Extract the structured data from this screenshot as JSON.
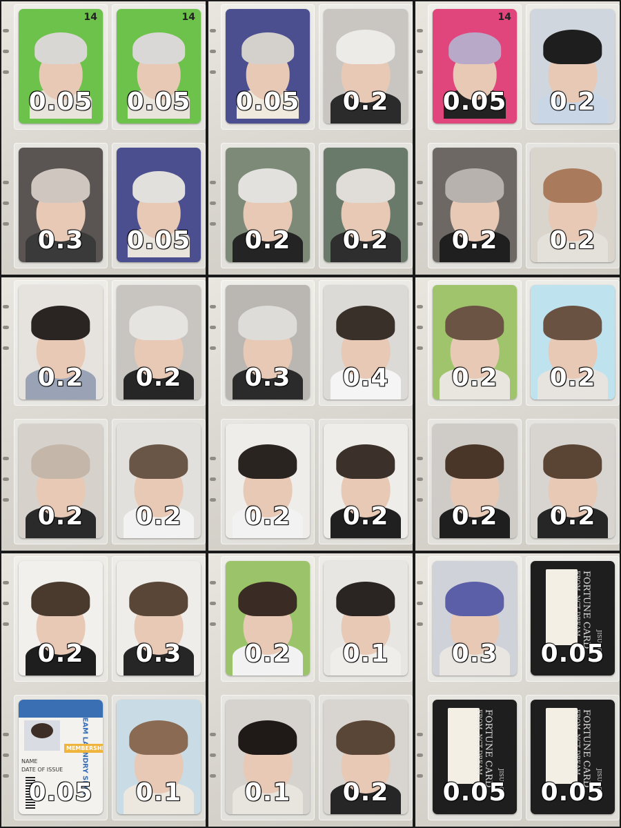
{
  "pages": [
    {
      "name": "page-1",
      "cards": [
        {
          "price": "0.05",
          "hair": "#d9d7d4",
          "bg": "#6cc24a",
          "shirt": "#e8e4dc",
          "frame": "green",
          "badge": "14"
        },
        {
          "price": "0.05",
          "hair": "#dad8d6",
          "bg": "#6cc24a",
          "shirt": "#e8e4dc",
          "frame": "green",
          "badge": "14"
        },
        {
          "price": "0.3",
          "hair": "#cfc7bf",
          "bg": "#5a5552",
          "shirt": "#3a3a3a",
          "frame": "none"
        },
        {
          "price": "0.05",
          "hair": "#e2e0dd",
          "bg": "#4b4f8f",
          "shirt": "#e8e4dc",
          "frame": "purple"
        }
      ]
    },
    {
      "name": "page-2",
      "cards": [
        {
          "price": "0.05",
          "hair": "#d4d1cc",
          "bg": "#4b4f8f",
          "shirt": "#efe9de",
          "frame": "purple"
        },
        {
          "price": "0.2",
          "hair": "#ecebe8",
          "bg": "#c9c6c2",
          "shirt": "#2b2b2b",
          "frame": "none"
        },
        {
          "price": "0.2",
          "hair": "#e3e1dd",
          "bg": "#7d8a78",
          "shirt": "#242424",
          "frame": "none"
        },
        {
          "price": "0.2",
          "hair": "#e0ddd8",
          "bg": "#6a7a6a",
          "shirt": "#2e2e2e",
          "frame": "none"
        }
      ]
    },
    {
      "name": "page-3",
      "cards": [
        {
          "price": "0.05",
          "hair": "#b9a9c9",
          "bg": "#e0457b",
          "shirt": "#222222",
          "frame": "pink",
          "badge": "14"
        },
        {
          "price": "0.2",
          "hair": "#1e1e1e",
          "bg": "#cfd6dd",
          "shirt": "#c9d6e6",
          "frame": "none"
        },
        {
          "price": "0.2",
          "hair": "#b7b2ad",
          "bg": "#6d6863",
          "shirt": "#1f1f1f",
          "frame": "none"
        },
        {
          "price": "0.2",
          "hair": "#a97a5c",
          "bg": "#d9d4cc",
          "shirt": "#e4e0da",
          "frame": "none"
        }
      ]
    },
    {
      "name": "page-4",
      "cards": [
        {
          "price": "0.2",
          "hair": "#2a2522",
          "bg": "#e6e3de",
          "shirt": "#9aa3b5",
          "frame": "none"
        },
        {
          "price": "0.2",
          "hair": "#e6e4e1",
          "bg": "#c8c4bf",
          "shirt": "#262626",
          "frame": "none"
        },
        {
          "price": "0.2",
          "hair": "#c4b6a8",
          "bg": "#d6d1cb",
          "shirt": "#2a2a2a",
          "frame": "none"
        },
        {
          "price": "0.2",
          "hair": "#6a5647",
          "bg": "#e2e0dc",
          "shirt": "#f2f2f2",
          "frame": "none"
        }
      ]
    },
    {
      "name": "page-5",
      "cards": [
        {
          "price": "0.3",
          "hair": "#dedcd8",
          "bg": "#bab6b1",
          "shirt": "#2b2b2b",
          "frame": "none"
        },
        {
          "price": "0.4",
          "hair": "#3a302a",
          "bg": "#dcdad6",
          "shirt": "#f5f5f5",
          "frame": "none"
        },
        {
          "price": "0.2",
          "hair": "#2a2420",
          "bg": "#efedea",
          "shirt": "#f2f2f2",
          "frame": "none"
        },
        {
          "price": "0.2",
          "hair": "#3b302a",
          "bg": "#efedea",
          "shirt": "#202020",
          "frame": "none"
        }
      ]
    },
    {
      "name": "page-6",
      "cards": [
        {
          "price": "0.2",
          "hair": "#6b5444",
          "bg": "#9fc46b",
          "shirt": "#e9e6e0",
          "frame": "none"
        },
        {
          "price": "0.2",
          "hair": "#6a5242",
          "bg": "#bfe3ee",
          "shirt": "#e7e3de",
          "frame": "none"
        },
        {
          "price": "0.2",
          "hair": "#4a3628",
          "bg": "#cfccc7",
          "shirt": "#1f1f1f",
          "frame": "none"
        },
        {
          "price": "0.2",
          "hair": "#5a4535",
          "bg": "#d8d5d0",
          "shirt": "#262626",
          "frame": "none"
        }
      ]
    },
    {
      "name": "page-7",
      "cards": [
        {
          "price": "0.2",
          "hair": "#4a3a2e",
          "bg": "#f2f0ec",
          "shirt": "#1e1e1e",
          "frame": "none"
        },
        {
          "price": "0.3",
          "hair": "#5a4636",
          "bg": "#efedea",
          "shirt": "#262626",
          "frame": "none"
        },
        {
          "price": "0.05",
          "hair": "#3d2f27",
          "bg": "#d9dde3",
          "shirt": "#f2f2f2",
          "frame": "idcard"
        },
        {
          "price": "0.1",
          "hair": "#8a6a52",
          "bg": "#c9dce6",
          "shirt": "#ece7df",
          "frame": "none"
        }
      ]
    },
    {
      "name": "page-8",
      "cards": [
        {
          "price": "0.2",
          "hair": "#3a2c24",
          "bg": "#9bc46a",
          "shirt": "#f2f2f2",
          "frame": "none"
        },
        {
          "price": "0.1",
          "hair": "#2a2522",
          "bg": "#e8e6e2",
          "shirt": "#f0eeea",
          "frame": "none"
        },
        {
          "price": "0.1",
          "hair": "#1f1a18",
          "bg": "#d6d2cd",
          "shirt": "#e8e4de",
          "frame": "none"
        },
        {
          "price": "0.2",
          "hair": "#5a4637",
          "bg": "#d8d4cf",
          "shirt": "#262626",
          "frame": "none"
        }
      ]
    },
    {
      "name": "page-9",
      "cards": [
        {
          "price": "0.3",
          "hair": "#5b5fa8",
          "bg": "#cfd2d8",
          "shirt": "#e9e6e2",
          "frame": "none"
        },
        {
          "price": "0.05",
          "hair": "",
          "bg": "#1e1e1e",
          "shirt": "",
          "frame": "fortune",
          "fortune_title": "FORTUNE CARD",
          "fortune_sub": "FROM. NCT DREAM",
          "fortune_name": "JISUNG"
        },
        {
          "price": "0.05",
          "hair": "",
          "bg": "#1e1e1e",
          "shirt": "",
          "frame": "fortune",
          "fortune_title": "FORTUNE CARD",
          "fortune_sub": "FROM. NCT DREAM",
          "fortune_name": "JISUNG"
        },
        {
          "price": "0.05",
          "hair": "",
          "bg": "#1e1e1e",
          "shirt": "",
          "frame": "fortune",
          "fortune_title": "FORTUNE CARD",
          "fortune_sub": "FROM. NCT DREAM",
          "fortune_name": "JISUNG"
        }
      ]
    }
  ],
  "id_card": {
    "header": "DREAM LAUNDRY SHOP",
    "fields": [
      "NAME",
      "DATE OF ISSUE"
    ],
    "badge": "MEMBERSHIP"
  }
}
